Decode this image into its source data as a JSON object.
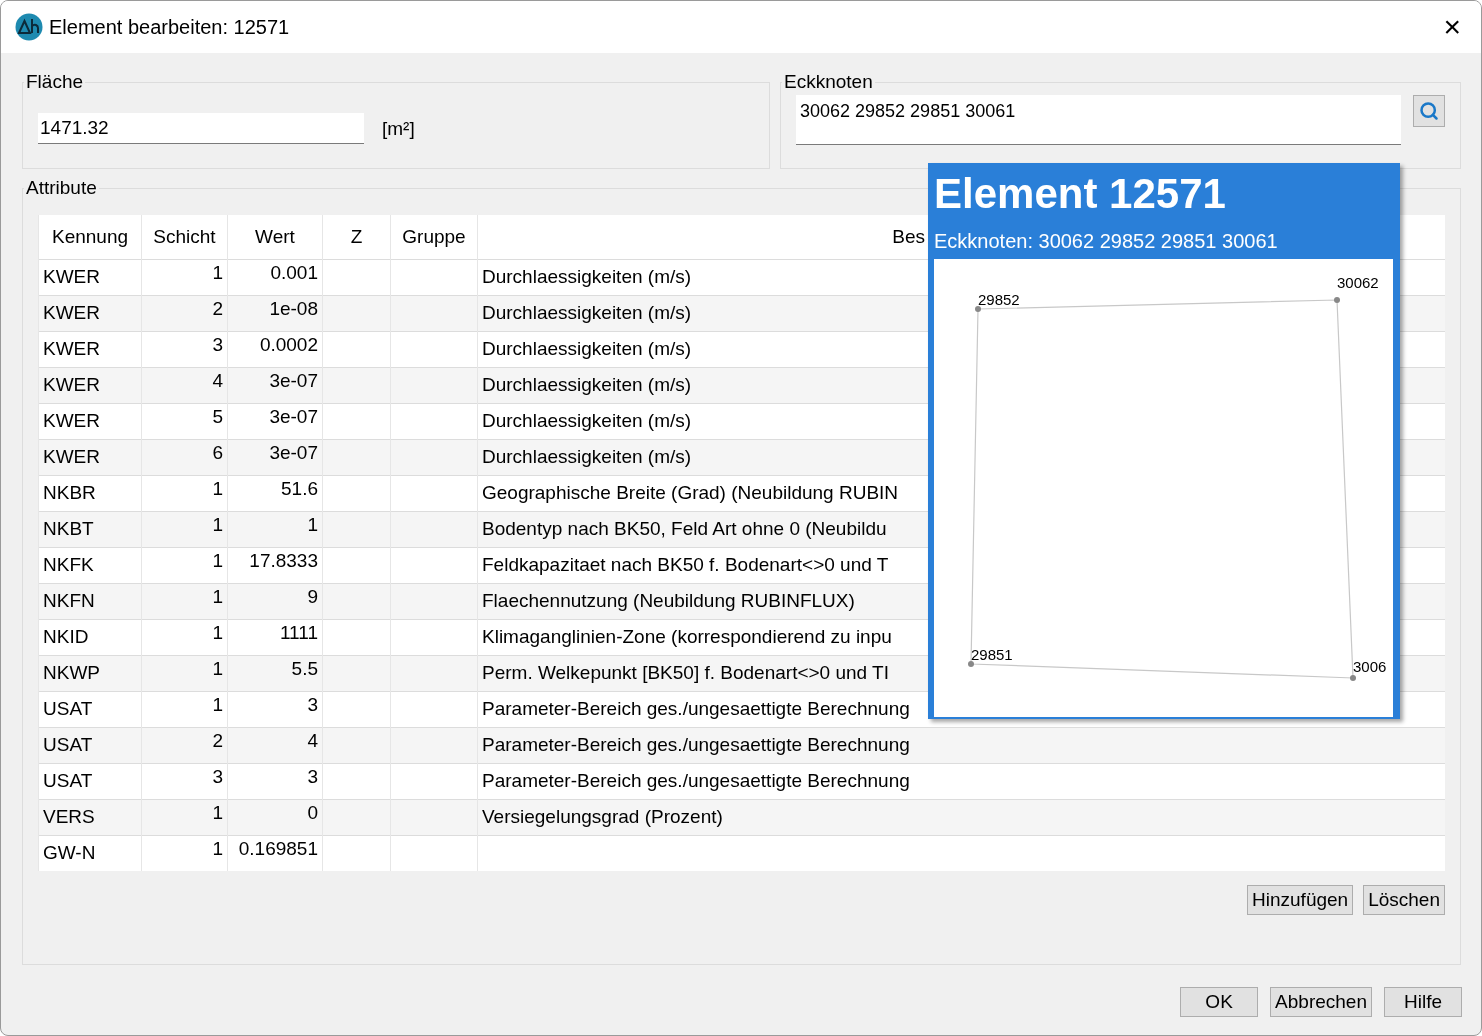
{
  "window": {
    "title": "Element bearbeiten: 12571",
    "close": "×"
  },
  "flaeche": {
    "label": "Fläche",
    "value": "1471.32",
    "unit": "[m²]"
  },
  "eckknoten": {
    "label": "Eckknoten",
    "value": "30062 29852 29851 30061"
  },
  "attribute": {
    "label": "Attribute",
    "columns": [
      "Kennung",
      "Schicht",
      "Wert",
      "Z",
      "Gruppe",
      "Bes"
    ],
    "rows": [
      [
        "KWER",
        "1",
        "0.001",
        "",
        "",
        "Durchlaessigkeiten (m/s)"
      ],
      [
        "KWER",
        "2",
        "1e-08",
        "",
        "",
        "Durchlaessigkeiten (m/s)"
      ],
      [
        "KWER",
        "3",
        "0.0002",
        "",
        "",
        "Durchlaessigkeiten (m/s)"
      ],
      [
        "KWER",
        "4",
        "3e-07",
        "",
        "",
        "Durchlaessigkeiten (m/s)"
      ],
      [
        "KWER",
        "5",
        "3e-07",
        "",
        "",
        "Durchlaessigkeiten (m/s)"
      ],
      [
        "KWER",
        "6",
        "3e-07",
        "",
        "",
        "Durchlaessigkeiten (m/s)"
      ],
      [
        "NKBR",
        "1",
        "51.6",
        "",
        "",
        "Geographische Breite (Grad) (Neubildung RUBIN"
      ],
      [
        "NKBT",
        "1",
        "1",
        "",
        "",
        "Bodentyp nach BK50, Feld Art ohne 0 (Neubildu"
      ],
      [
        "NKFK",
        "1",
        "17.8333",
        "",
        "",
        "Feldkapazitaet nach BK50 f. Bodenart<>0 und T"
      ],
      [
        "NKFN",
        "1",
        "9",
        "",
        "",
        "Flaechennutzung (Neubildung RUBINFLUX)"
      ],
      [
        "NKID",
        "1",
        "1111",
        "",
        "",
        "Klimaganglinien-Zone (korrespondierend zu inpu"
      ],
      [
        "NKWP",
        "1",
        "5.5",
        "",
        "",
        "Perm. Welkepunkt [BK50] f. Bodenart<>0 und TI"
      ],
      [
        "USAT",
        "1",
        "3",
        "",
        "",
        "Parameter-Bereich ges./ungesaettigte Berechnung"
      ],
      [
        "USAT",
        "2",
        "4",
        "",
        "",
        "Parameter-Bereich ges./ungesaettigte Berechnung"
      ],
      [
        "USAT",
        "3",
        "3",
        "",
        "",
        "Parameter-Bereich ges./ungesaettigte Berechnung"
      ],
      [
        "VERS",
        "1",
        "0",
        "",
        "",
        "Versiegelungsgrad (Prozent)"
      ],
      [
        "GW-N",
        "1",
        "0.169851",
        "",
        "",
        ""
      ]
    ],
    "buttons": [
      "Hinzufügen",
      "Löschen"
    ]
  },
  "tooltip": {
    "title": "Element 12571",
    "subtitle": "Eckknoten: 30062 29852 29851 30061",
    "nodes": [
      "29852",
      "30062",
      "3006",
      "29851"
    ]
  },
  "buttons": [
    "OK",
    "Abbrechen",
    "Hilfe"
  ]
}
